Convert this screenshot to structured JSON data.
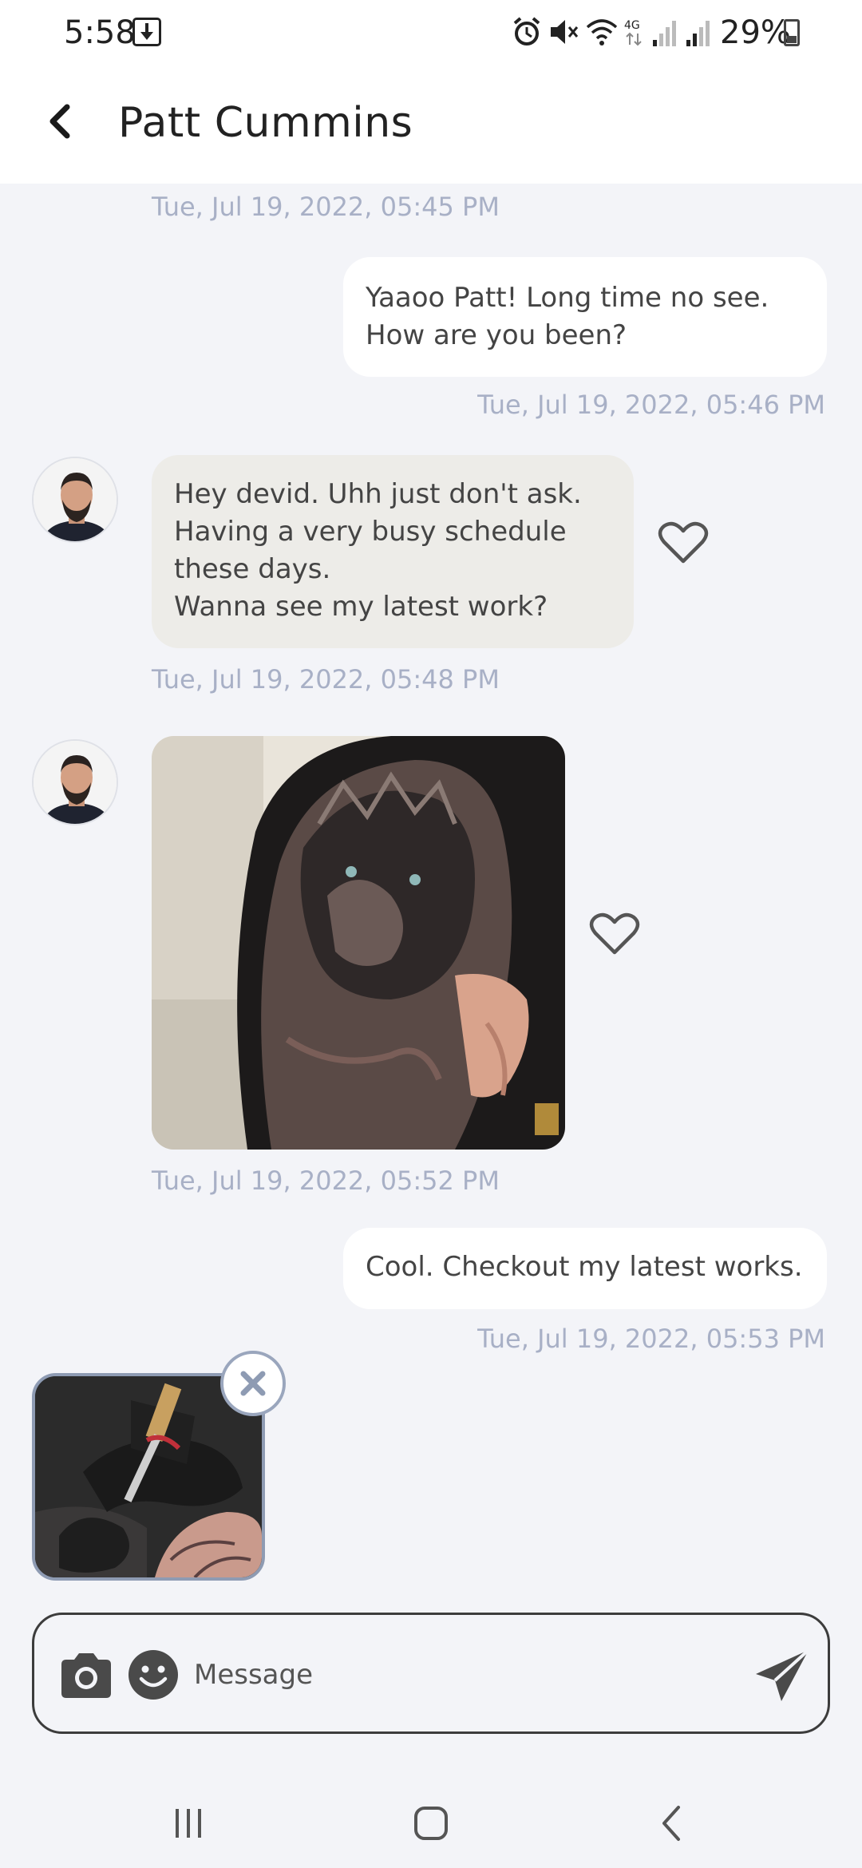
{
  "status_bar": {
    "time": "5:58",
    "battery": "29%",
    "icons": [
      "download-icon",
      "alarm-icon",
      "mute-icon",
      "wifi-icon",
      "4g-icon",
      "signal-icon",
      "signal-icon",
      "battery-icon"
    ]
  },
  "header": {
    "title": "Patt Cummins"
  },
  "messages": [
    {
      "type": "timestamp",
      "time": "Tue, Jul 19, 2022, 05:45 PM"
    },
    {
      "type": "outgoing",
      "text": "Yaaoo Patt! Long time no see.\nHow are you been?",
      "time": "Tue, Jul 19, 2022, 05:46 PM"
    },
    {
      "type": "incoming",
      "text": "Hey devid. Uhh just don't ask.\nHaving a very busy schedule\nthese days.\nWanna see my latest work?",
      "time": "Tue, Jul 19, 2022, 05:48 PM"
    },
    {
      "type": "incoming-image",
      "time": "Tue, Jul 19, 2022, 05:52 PM"
    },
    {
      "type": "outgoing",
      "text": "Cool. Checkout my latest works.",
      "time": "Tue, Jul 19, 2022, 05:53 PM"
    }
  ],
  "composer": {
    "placeholder": "Message"
  },
  "colors": {
    "background": "#f3f4f8",
    "incoming_bubble": "#edece8",
    "outgoing_bubble": "#ffffff",
    "timestamp": "#a8b0c6"
  }
}
